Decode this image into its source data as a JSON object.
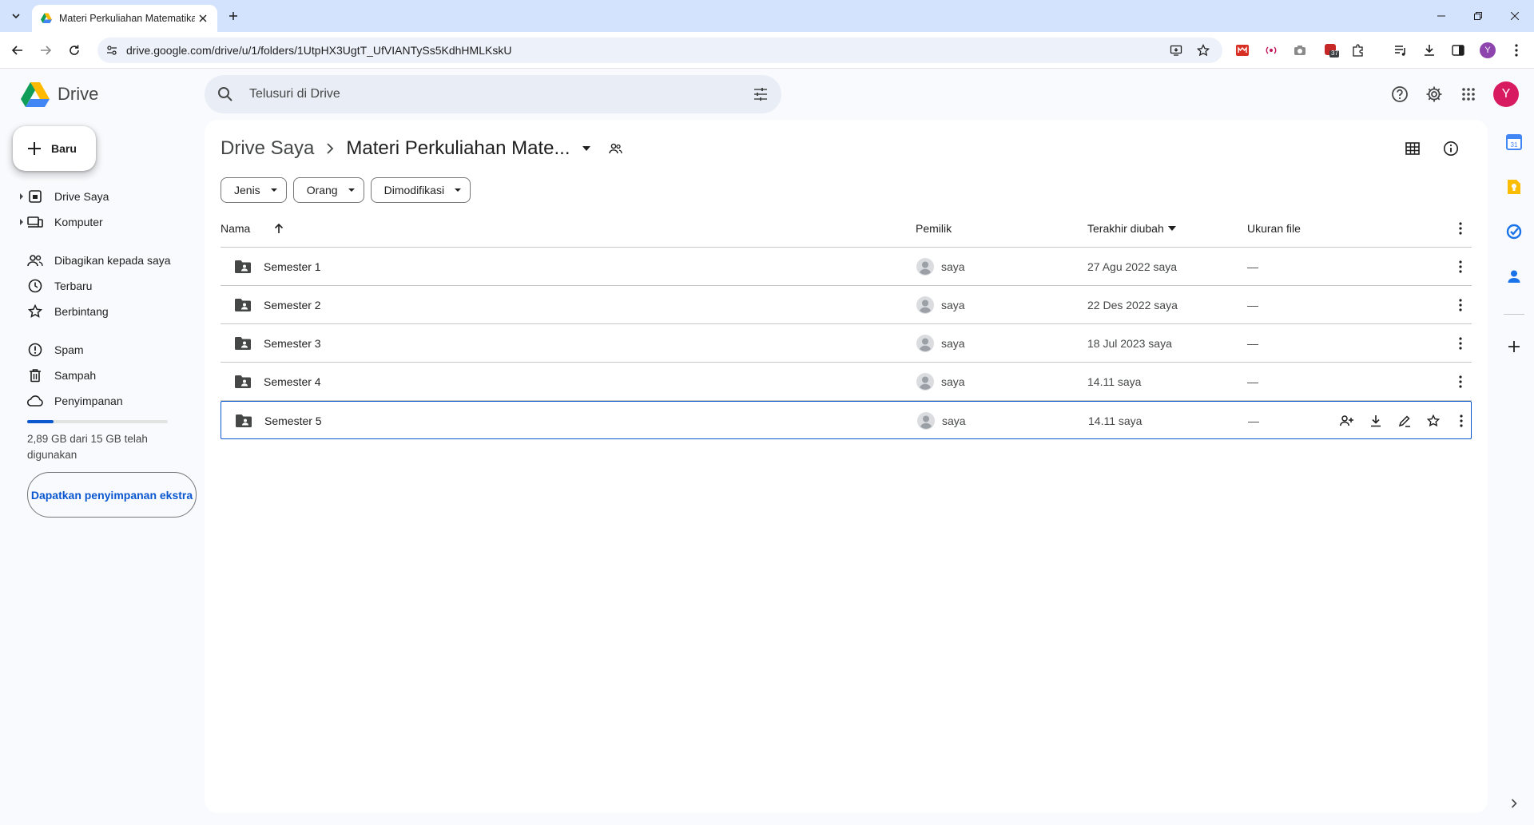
{
  "browser": {
    "tab_title": "Materi Perkuliahan Matematika",
    "url": "drive.google.com/drive/u/1/folders/1UtpHX3UgtT_UfVIANTySs5KdhHMLKskU",
    "profile_initial": "Y",
    "extension_badge": "37"
  },
  "app": {
    "name": "Drive",
    "search_placeholder": "Telusuri di Drive",
    "avatar_initial": "Y"
  },
  "sidebar": {
    "new_label": "Baru",
    "items": [
      {
        "label": "Drive Saya",
        "icon": "my-drive-icon"
      },
      {
        "label": "Komputer",
        "icon": "computer-icon"
      },
      {
        "label": "Dibagikan kepada saya",
        "icon": "shared-icon"
      },
      {
        "label": "Terbaru",
        "icon": "clock-icon"
      },
      {
        "label": "Berbintang",
        "icon": "star-icon"
      },
      {
        "label": "Spam",
        "icon": "spam-icon"
      },
      {
        "label": "Sampah",
        "icon": "trash-icon"
      },
      {
        "label": "Penyimpanan",
        "icon": "cloud-icon"
      }
    ],
    "storage": {
      "used_fraction": 0.19,
      "text": "2,89 GB dari 15 GB telah digunakan",
      "button_label": "Dapatkan penyimpanan ekstra"
    }
  },
  "breadcrumb": {
    "root": "Drive Saya",
    "current": "Materi Perkuliahan Mate..."
  },
  "filters": [
    "Jenis",
    "Orang",
    "Dimodifikasi"
  ],
  "table": {
    "headers": {
      "name": "Nama",
      "owner": "Pemilik",
      "modified": "Terakhir diubah",
      "size": "Ukuran file"
    },
    "rows": [
      {
        "name": "Semester 1",
        "owner": "saya",
        "modified": "27 Agu 2022 saya",
        "size": "—"
      },
      {
        "name": "Semester 2",
        "owner": "saya",
        "modified": "22 Des 2022 saya",
        "size": "—"
      },
      {
        "name": "Semester 3",
        "owner": "saya",
        "modified": "18 Jul 2023 saya",
        "size": "—"
      },
      {
        "name": "Semester 4",
        "owner": "saya",
        "modified": "14.11 saya",
        "size": "—"
      },
      {
        "name": "Semester 5",
        "owner": "saya",
        "modified": "14.11 saya",
        "size": "—",
        "selected": true
      }
    ]
  },
  "colors": {
    "accent": "#0b57d0",
    "chrome_tabstrip": "#d3e3fd",
    "page_bg": "#f8fafd",
    "avatar": "#d81b60"
  }
}
